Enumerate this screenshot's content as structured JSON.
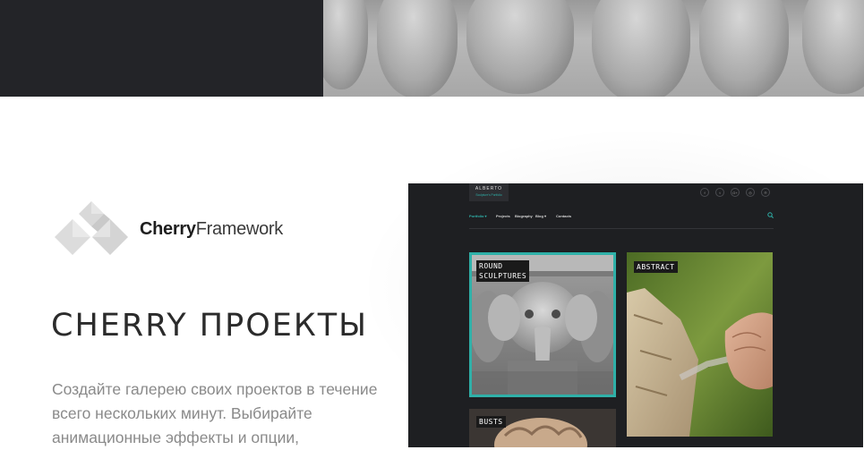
{
  "logo": {
    "name_bold": "Cherry",
    "name_regular": "Framework"
  },
  "section": {
    "heading": "CHERRY ПРОЕКТЫ",
    "description": "Создайте галерею своих проектов в течение всего нескольких минут. Выбирайте анимационные эффекты и опции,"
  },
  "mockup": {
    "site_title": "ALBERTO",
    "site_tagline": "Sculpture's Portfolio",
    "social_icons": [
      "facebook-icon",
      "twitter-icon",
      "google-plus-icon",
      "instagram-icon",
      "pinterest-icon"
    ],
    "social_glyphs": [
      "f",
      "t",
      "G+",
      "◎",
      "℗"
    ],
    "nav": [
      {
        "label": "Portfolio ▾",
        "active": true
      },
      {
        "label": "Projects",
        "active": false
      },
      {
        "label": "Biography",
        "active": false
      },
      {
        "label": "Blog ▾",
        "active": false
      },
      {
        "label": "Contacts",
        "active": false
      }
    ],
    "cards": [
      {
        "label_line1": "ROUND",
        "label_line2": "SCULPTURES"
      },
      {
        "label": "ABSTRACT"
      },
      {
        "label": "BUSTS"
      }
    ],
    "accent": "#2fb0a8"
  },
  "colors": {
    "dark_band": "#232428",
    "heading": "#2b2b2b",
    "body_text": "#8a8a8a"
  }
}
